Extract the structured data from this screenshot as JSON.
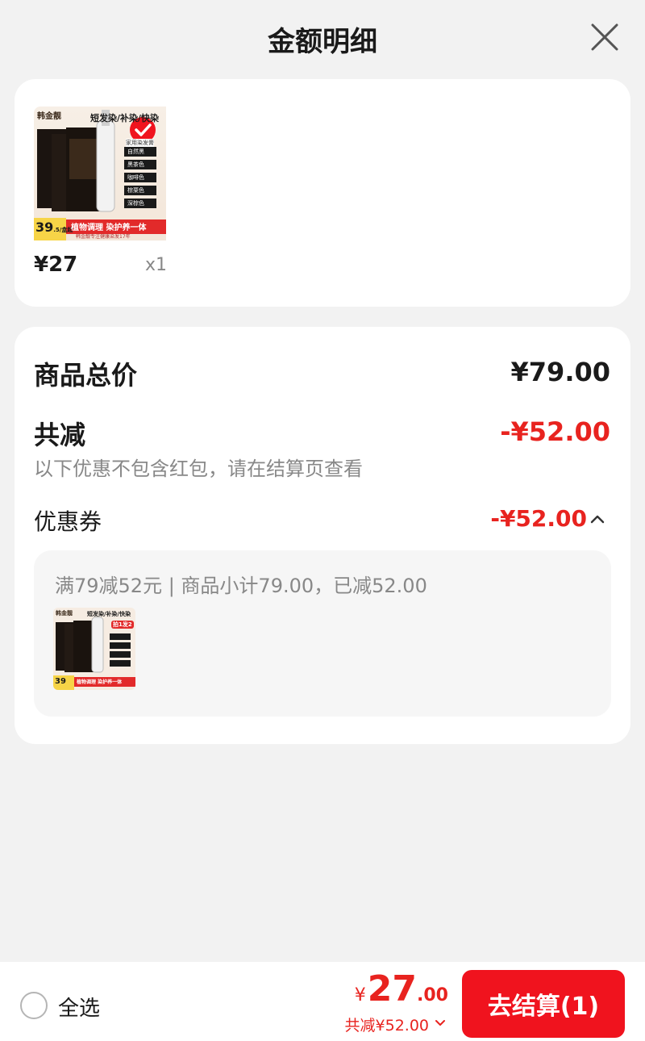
{
  "header": {
    "title": "金额明细"
  },
  "product": {
    "price": "¥27",
    "quantity": "x1",
    "image": {
      "brand": "韩金靓",
      "headline": "短发染/补染/快染",
      "badge": "拍1发2",
      "tag": "家用染发膏",
      "price_int": "39",
      "price_dec": ".5/盒起",
      "banner": "植物调理 染护养一体",
      "subline": "韩金靓专注健康染发17年",
      "colors": [
        "自然黑",
        "黑茶色",
        "咖啡色",
        "棕栗色",
        "深棕色"
      ]
    }
  },
  "summary": {
    "total_label": "商品总价",
    "total_value": "¥79.00",
    "reduce_label": "共减",
    "reduce_value": "-¥52.00",
    "note": "以下优惠不包含红包，请在结算页查看",
    "coupon_label": "优惠券",
    "coupon_value": "-¥52.00",
    "coupon_desc": "满79减52元 | 商品小计79.00，已减52.00"
  },
  "footer": {
    "select_all": "全选",
    "currency": "¥",
    "total_int": "27",
    "total_dec": ".00",
    "reduce_text": "共减¥52.00",
    "checkout": "去结算(1)"
  },
  "colors": {
    "accent_red": "#e8231f",
    "button_red": "#f0131e",
    "background": "#f2f2f2"
  }
}
